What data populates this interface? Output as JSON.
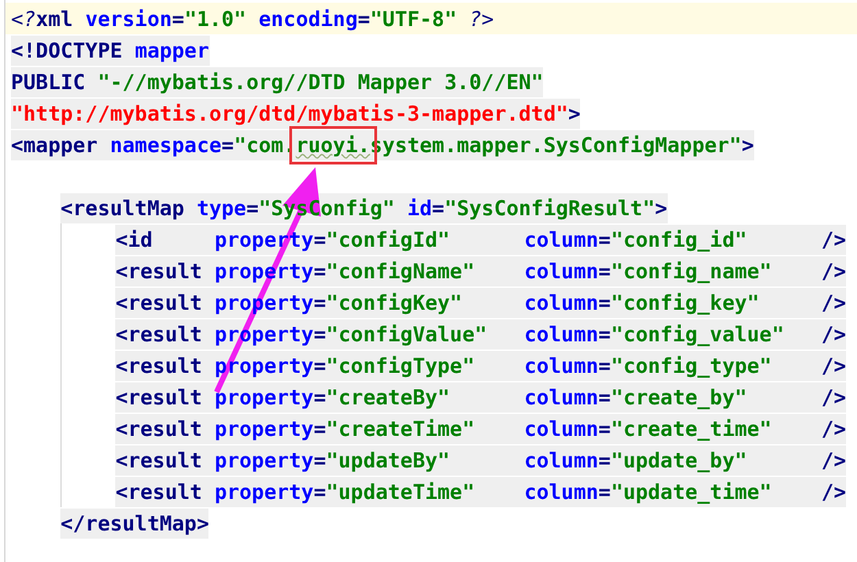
{
  "editor": {
    "lines": [
      {
        "current": true,
        "tokens": [
          {
            "kind": "pi",
            "text": "<?"
          },
          {
            "kind": "tag",
            "text": "xml"
          },
          {
            "kind": "attr",
            "name": "version",
            "eq": "=",
            "value": "\"1.0\""
          },
          {
            "kind": "attr",
            "name": "encoding",
            "eq": "=",
            "value": "\"UTF-8\""
          },
          {
            "kind": "pi",
            "text": "?>"
          }
        ]
      },
      {
        "current": false,
        "tokens": [
          {
            "kind": "tag",
            "text": "<!DOCTYPE"
          },
          {
            "kind": "name",
            "text": "mapper"
          }
        ]
      },
      {
        "current": false,
        "tokens": [
          {
            "kind": "tag",
            "text": "PUBLIC"
          },
          {
            "kind": "value",
            "text": "\"-//mybatis.org//DTD Mapper 3.0//EN\""
          }
        ]
      },
      {
        "current": false,
        "tokens": [
          {
            "kind": "url",
            "text": "\"http://mybatis.org/dtd/mybatis-3-mapper.dtd\""
          },
          {
            "kind": "bracket",
            "text": ">"
          }
        ]
      },
      {
        "current": false,
        "tokens": [
          {
            "kind": "tag",
            "text": "<mapper"
          },
          {
            "kind": "attr",
            "name": "namespace",
            "eq": "=",
            "value": "\"com."
          },
          {
            "kind": "value",
            "text": "ruoyi.",
            "boxed": true
          },
          {
            "kind": "value",
            "text": "system.mapper.SysConfigMapper\""
          },
          {
            "kind": "bracket",
            "text": ">"
          }
        ],
        "children": [
          {
            "current": false,
            "tokens": [
              {
                "kind": "tag",
                "text": "<resultMap"
              },
              {
                "kind": "attr",
                "name": "type",
                "eq": "=",
                "value": "\"SysConfig\""
              },
              {
                "kind": "attr",
                "name": "id",
                "eq": "=",
                "value": "\"SysConfigResult\""
              },
              {
                "kind": "bracket",
                "text": ">"
              }
            ],
            "children": [
              {
                "current": false,
                "aligned": true,
                "tokens": [
                  {
                    "kind": "tag",
                    "text": "<id"
                  },
                  {
                    "kind": "attr",
                    "name": "property",
                    "eq": "=",
                    "value": "\"configId\""
                  },
                  {
                    "kind": "attr",
                    "name": "column",
                    "eq": "=",
                    "value": "\"config_id\""
                  },
                  {
                    "kind": "bracket",
                    "text": "/>"
                  }
                ]
              },
              {
                "current": false,
                "aligned": true,
                "tokens": [
                  {
                    "kind": "tag",
                    "text": "<result"
                  },
                  {
                    "kind": "attr",
                    "name": "property",
                    "eq": "=",
                    "value": "\"configName\""
                  },
                  {
                    "kind": "attr",
                    "name": "column",
                    "eq": "=",
                    "value": "\"config_name\""
                  },
                  {
                    "kind": "bracket",
                    "text": "/>"
                  }
                ]
              },
              {
                "current": false,
                "aligned": true,
                "tokens": [
                  {
                    "kind": "tag",
                    "text": "<result"
                  },
                  {
                    "kind": "attr",
                    "name": "property",
                    "eq": "=",
                    "value": "\"configKey\""
                  },
                  {
                    "kind": "attr",
                    "name": "column",
                    "eq": "=",
                    "value": "\"config_key\""
                  },
                  {
                    "kind": "bracket",
                    "text": "/>"
                  }
                ]
              },
              {
                "current": false,
                "aligned": true,
                "tokens": [
                  {
                    "kind": "tag",
                    "text": "<result"
                  },
                  {
                    "kind": "attr",
                    "name": "property",
                    "eq": "=",
                    "value": "\"configValue\""
                  },
                  {
                    "kind": "attr",
                    "name": "column",
                    "eq": "=",
                    "value": "\"config_value\""
                  },
                  {
                    "kind": "bracket",
                    "text": "/>"
                  }
                ]
              },
              {
                "current": false,
                "aligned": true,
                "tokens": [
                  {
                    "kind": "tag",
                    "text": "<result"
                  },
                  {
                    "kind": "attr",
                    "name": "property",
                    "eq": "=",
                    "value": "\"configType\""
                  },
                  {
                    "kind": "attr",
                    "name": "column",
                    "eq": "=",
                    "value": "\"config_type\""
                  },
                  {
                    "kind": "bracket",
                    "text": "/>"
                  }
                ]
              },
              {
                "current": false,
                "aligned": true,
                "tokens": [
                  {
                    "kind": "tag",
                    "text": "<result"
                  },
                  {
                    "kind": "attr",
                    "name": "property",
                    "eq": "=",
                    "value": "\"createBy\""
                  },
                  {
                    "kind": "attr",
                    "name": "column",
                    "eq": "=",
                    "value": "\"create_by\""
                  },
                  {
                    "kind": "bracket",
                    "text": "/>"
                  }
                ]
              },
              {
                "current": false,
                "aligned": true,
                "tokens": [
                  {
                    "kind": "tag",
                    "text": "<result"
                  },
                  {
                    "kind": "attr",
                    "name": "property",
                    "eq": "=",
                    "value": "\"createTime\""
                  },
                  {
                    "kind": "attr",
                    "name": "column",
                    "eq": "=",
                    "value": "\"create_time\""
                  },
                  {
                    "kind": "bracket",
                    "text": "/>"
                  }
                ]
              },
              {
                "current": false,
                "aligned": true,
                "tokens": [
                  {
                    "kind": "tag",
                    "text": "<result"
                  },
                  {
                    "kind": "attr",
                    "name": "property",
                    "eq": "=",
                    "value": "\"updateBy\""
                  },
                  {
                    "kind": "attr",
                    "name": "column",
                    "eq": "=",
                    "value": "\"update_by\""
                  },
                  {
                    "kind": "bracket",
                    "text": "/>"
                  }
                ]
              },
              {
                "current": false,
                "aligned": true,
                "tokens": [
                  {
                    "kind": "tag",
                    "text": "<result"
                  },
                  {
                    "kind": "attr",
                    "name": "property",
                    "eq": "=",
                    "value": "\"updateTime\""
                  },
                  {
                    "kind": "attr",
                    "name": "column",
                    "eq": "=",
                    "value": "\"update_time\""
                  },
                  {
                    "kind": "bracket",
                    "text": "/>"
                  }
                ]
              }
            ]
          },
          {
            "current": false,
            "tokens": [
              {
                "kind": "tag",
                "text": "</resultMap"
              },
              {
                "kind": "bracket",
                "text": ">"
              }
            ]
          }
        ]
      }
    ]
  }
}
